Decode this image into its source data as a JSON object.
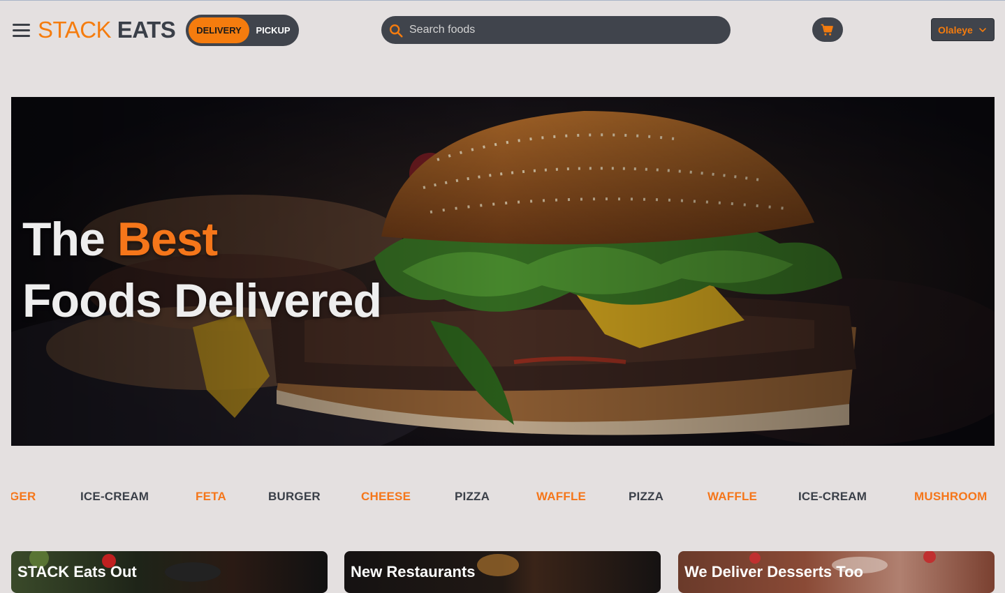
{
  "header": {
    "logo_part1": "STACK",
    "logo_part2": "EATS",
    "mode_active": "DELIVERY",
    "mode_inactive": "PICKUP",
    "search_placeholder": "Search foods",
    "user_name": "Olaleye"
  },
  "hero": {
    "title_part1": "The",
    "title_accent": "Best",
    "title_line2": "Foods Delivered"
  },
  "ticker": [
    {
      "label": "GER",
      "tone": "orange"
    },
    {
      "label": "ICE-CREAM",
      "tone": "gray"
    },
    {
      "label": "FETA",
      "tone": "orange"
    },
    {
      "label": "BURGER",
      "tone": "gray"
    },
    {
      "label": "CHEESE",
      "tone": "orange"
    },
    {
      "label": "PIZZA",
      "tone": "gray"
    },
    {
      "label": "WAFFLE",
      "tone": "orange"
    },
    {
      "label": "PIZZA",
      "tone": "gray"
    },
    {
      "label": "WAFFLE",
      "tone": "orange"
    },
    {
      "label": "ICE-CREAM",
      "tone": "gray"
    },
    {
      "label": "MUSHROOM",
      "tone": "orange"
    }
  ],
  "cards": [
    {
      "title": "STACK Eats Out"
    },
    {
      "title": "New Restaurants"
    },
    {
      "title": "We Deliver Desserts Too"
    }
  ],
  "colors": {
    "accent": "#f57c0e",
    "dark": "#40444c",
    "background": "#e4e0e0"
  },
  "icons": [
    "hamburger-menu-icon",
    "search-icon",
    "cart-icon",
    "chevron-down-icon"
  ]
}
